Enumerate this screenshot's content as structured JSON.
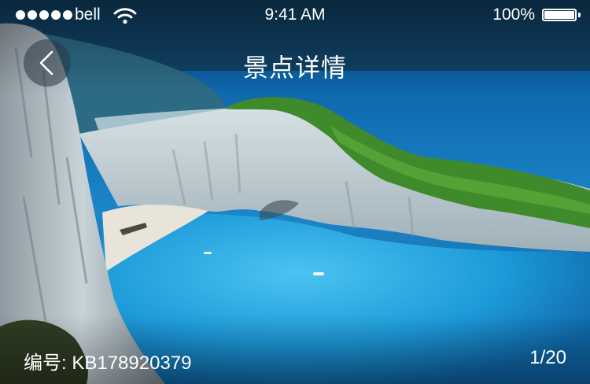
{
  "status_bar": {
    "carrier": "bell",
    "time": "9:41 AM",
    "battery": "100%",
    "signal_bars": 5,
    "icons": [
      "signal-dots-icon",
      "wifi-icon",
      "battery-icon"
    ]
  },
  "nav": {
    "title": "景点详情",
    "back_icon": "chevron-left-icon"
  },
  "photo": {
    "description_icon": "scenic-photo"
  },
  "info": {
    "code_label": "编号:",
    "code_value": "KB178920379",
    "pager": "1/20"
  },
  "colors": {
    "text": "#ffffff",
    "sea": "#1f8fd0",
    "back_button_bg": "#28374699"
  }
}
